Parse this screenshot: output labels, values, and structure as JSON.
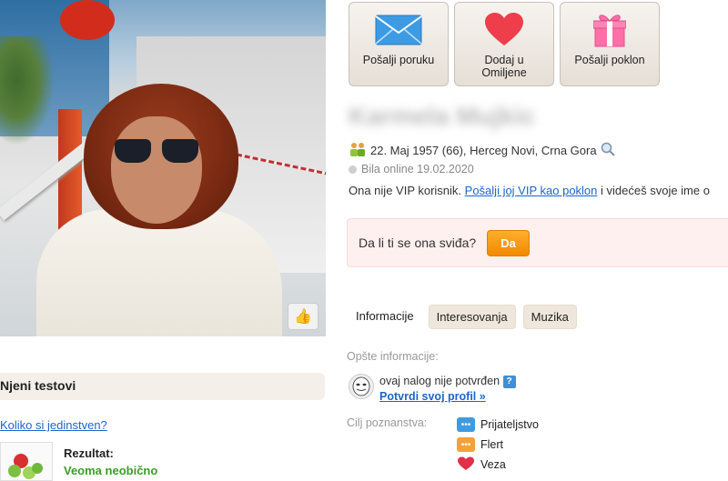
{
  "actions": [
    {
      "label": "Pošalji poruku",
      "icon": "envelope-icon"
    },
    {
      "label": "Dodaj u Omiljene",
      "icon": "heart-icon"
    },
    {
      "label": "Pošalji poklon",
      "icon": "gift-icon"
    }
  ],
  "profile": {
    "name_blurred": "Karmela Mujkic",
    "birth_line": "22. Maj 1957 (66), Herceg Novi, Crna Gora",
    "online_status": "Bila online 19.02.2020",
    "vip_text_before": "Ona nije VIP korisnik. ",
    "vip_link": "Pošalji joj VIP kao poklon",
    "vip_text_after": " i videćeš svoje ime o"
  },
  "like_prompt": {
    "question": "Da li ti se ona sviđa?",
    "button": "Da"
  },
  "tabs": [
    {
      "label": "Informacije",
      "active": true
    },
    {
      "label": "Interesovanja",
      "active": false
    },
    {
      "label": "Muzika",
      "active": false
    }
  ],
  "general_info": {
    "label": "Opšte informacije:",
    "unverified_text": "ovaj nalog nije potvrđen",
    "verify_link": "Potvrdi svoj profil »"
  },
  "goals": {
    "label": "Cilj poznanstva:",
    "items": [
      {
        "label": "Prijateljstvo",
        "icon": "chat-icon",
        "color": "#3f9be0"
      },
      {
        "label": "Flert",
        "icon": "chat-icon",
        "color": "#f3a23a"
      },
      {
        "label": "Veza",
        "icon": "heart-icon",
        "color": "#e0304a"
      }
    ]
  },
  "tests": {
    "title": "Njeni testovi",
    "link": "Koliko si jedinstven?",
    "result_label": "Rezultat:",
    "result_value": "Veoma neobično"
  }
}
